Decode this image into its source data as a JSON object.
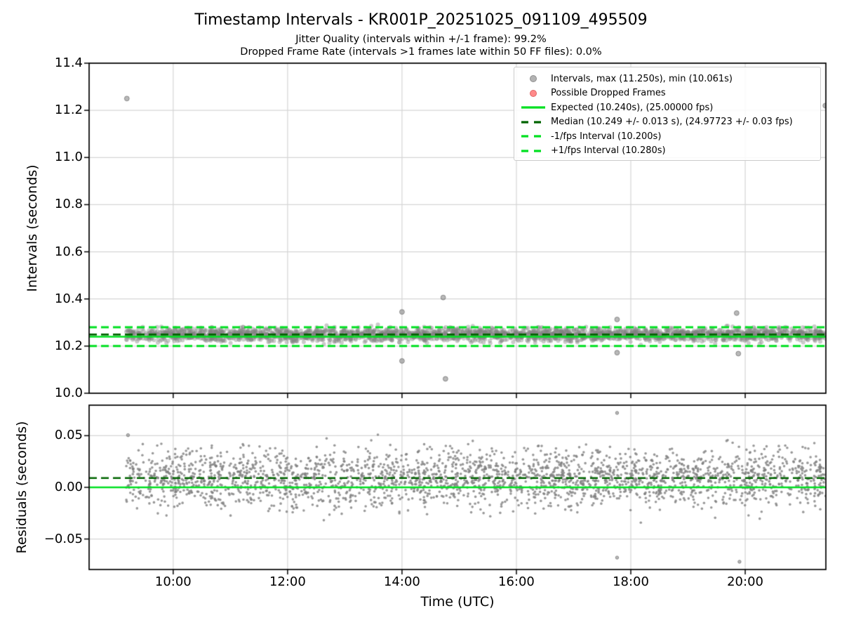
{
  "figure": {
    "title": "Timestamp Intervals - KR001P_20251025_091109_495509",
    "subtitle1": "Jitter Quality (intervals within +/-1 frame): 99.2%",
    "subtitle2": "Dropped Frame Rate (intervals >1 frames late within 50 FF files): 0.0%",
    "background": "#ffffff"
  },
  "colors": {
    "scatter_gray": "#808080",
    "expected_green": "#00e021",
    "median_darkgreen": "#006400",
    "dropped_red": "#ff8a8a",
    "grid": "#d5d5d5",
    "axis": "#000000"
  },
  "legend": {
    "position": "upper right",
    "entries": [
      {
        "marker": "dot",
        "color": "#b3b3b3",
        "edge": "#8f8f8f",
        "label": "Intervals, max (11.250s), min (10.061s)"
      },
      {
        "marker": "dot",
        "color": "#ff8a8a",
        "edge": "#e06666",
        "label": "Possible Dropped Frames"
      },
      {
        "marker": "line",
        "dash": "solid",
        "color": "#00e021",
        "label": "Expected (10.240s), (25.00000 fps)"
      },
      {
        "marker": "line",
        "dash": "dashed",
        "color": "#006400",
        "label": "Median (10.249 +/- 0.013 s), (24.97723 +/- 0.03 fps)"
      },
      {
        "marker": "line",
        "dash": "dashed",
        "color": "#00e021",
        "label": "-1/fps Interval (10.200s)"
      },
      {
        "marker": "line",
        "dash": "dashed",
        "color": "#00e021",
        "label": "+1/fps Interval (10.280s)"
      }
    ]
  },
  "chart_data": [
    {
      "type": "scatter",
      "name": "timestamp-intervals",
      "ylabel": "Intervals (seconds)",
      "ylim": [
        10.0,
        11.4
      ],
      "yticks": [
        {
          "v": 10.0,
          "label": "10.0"
        },
        {
          "v": 10.2,
          "label": "10.2"
        },
        {
          "v": 10.4,
          "label": "10.4"
        },
        {
          "v": 10.6,
          "label": "10.6"
        },
        {
          "v": 10.8,
          "label": "10.8"
        },
        {
          "v": 11.0,
          "label": "11.0"
        },
        {
          "v": 11.2,
          "label": "11.2"
        },
        {
          "v": 11.4,
          "label": "11.4"
        }
      ],
      "xlim_hours": [
        8.53,
        21.41
      ],
      "grid": true,
      "cloud": {
        "t_start": 9.18,
        "t_end": 21.41,
        "n": 2600,
        "center": 10.249,
        "sigma": 0.014,
        "clip_sigma": 3.2,
        "radius": 3.0,
        "alpha": 0.42
      },
      "ref_lines": [
        {
          "name": "expected",
          "value": 10.24,
          "color": "#00e021",
          "dash": "solid",
          "width": 2.6
        },
        {
          "name": "median",
          "value": 10.249,
          "color": "#006400",
          "dash": "long",
          "width": 2.6
        },
        {
          "name": "minus-1fps",
          "value": 10.2,
          "color": "#00e021",
          "dash": "long",
          "width": 3.0
        },
        {
          "name": "plus-1fps",
          "value": 10.28,
          "color": "#00e021",
          "dash": "long",
          "width": 3.0
        }
      ],
      "outliers": [
        [
          9.19,
          11.25
        ],
        [
          14.0,
          10.345
        ],
        [
          14.0,
          10.137
        ],
        [
          14.72,
          10.406
        ],
        [
          14.76,
          10.061
        ],
        [
          17.76,
          10.313
        ],
        [
          17.76,
          10.172
        ],
        [
          19.85,
          10.34
        ],
        [
          19.88,
          10.168
        ],
        [
          21.4,
          11.22
        ]
      ],
      "stats": {
        "max_s": 11.25,
        "min_s": 10.061,
        "expected_s": 10.24,
        "expected_fps": 25.0,
        "median_s": 10.249,
        "median_s_pm": 0.013,
        "median_fps": 24.97723,
        "median_fps_pm": 0.03,
        "minus_1fps_interval_s": 10.2,
        "plus_1fps_interval_s": 10.28,
        "jitter_quality_pct": 99.2,
        "dropped_frame_rate_pct": 0.0
      }
    },
    {
      "type": "scatter",
      "name": "residuals",
      "ylabel": "Residuals (seconds)",
      "xlabel": "Time (UTC)",
      "ylim": [
        -0.0795,
        0.0795
      ],
      "yticks": [
        {
          "v": -0.05,
          "label": "−0.05"
        },
        {
          "v": 0.0,
          "label": "0.00"
        },
        {
          "v": 0.05,
          "label": "0.05"
        }
      ],
      "xticks": [
        {
          "v": 10,
          "label": "10:00"
        },
        {
          "v": 12,
          "label": "12:00"
        },
        {
          "v": 14,
          "label": "14:00"
        },
        {
          "v": 16,
          "label": "16:00"
        },
        {
          "v": 18,
          "label": "18:00"
        },
        {
          "v": 20,
          "label": "20:00"
        }
      ],
      "xlim_hours": [
        8.53,
        21.41
      ],
      "grid": true,
      "cloud": {
        "center": 0.009,
        "sigma": 0.014,
        "clip_sigma": 3.2,
        "radius": 1.8,
        "alpha": 0.8
      },
      "ref_lines": [
        {
          "name": "expected",
          "value": 0.0,
          "color": "#00e021",
          "dash": "solid",
          "width": 2.6
        },
        {
          "name": "median",
          "value": 0.009,
          "color": "#006400",
          "dash": "long",
          "width": 2.6
        }
      ],
      "outliers": [
        [
          9.21,
          0.0505
        ],
        [
          17.76,
          0.072
        ],
        [
          17.76,
          -0.068
        ],
        [
          19.9,
          -0.072
        ]
      ]
    }
  ]
}
